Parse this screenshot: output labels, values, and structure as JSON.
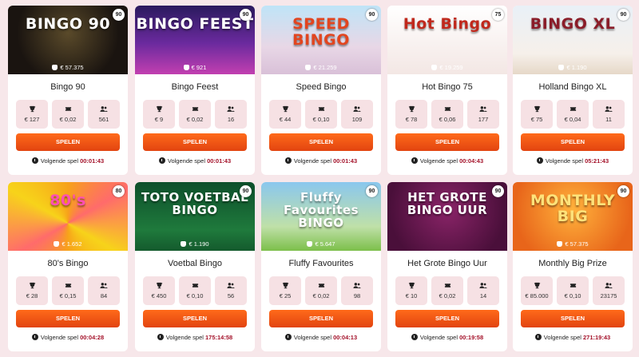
{
  "labels": {
    "play": "SPELEN",
    "next_game": "Volgende spel"
  },
  "colors": {
    "page_bg": "#f7e7ea",
    "button": "#f05a16",
    "time": "#a4122a",
    "stat_bg": "#f6e1e4"
  },
  "games": [
    {
      "name": "Bingo 90",
      "banner_text": "BINGO 90",
      "balls": "90",
      "jackpot": "€ 57.375",
      "prize": "€ 127",
      "ticket": "€ 0,02",
      "players": "561",
      "time": "00:01:43",
      "theme": "gold"
    },
    {
      "name": "Bingo Feest",
      "banner_text": "BINGO FEEST",
      "balls": "90",
      "jackpot": "€ 921",
      "prize": "€ 9",
      "ticket": "€ 0,02",
      "players": "16",
      "time": "00:01:43",
      "theme": "purple"
    },
    {
      "name": "Speed Bingo",
      "banner_text": "SPEED BINGO",
      "balls": "90",
      "jackpot": "€ 21.259",
      "prize": "€ 44",
      "ticket": "€ 0,10",
      "players": "109",
      "time": "00:01:43",
      "theme": "sky"
    },
    {
      "name": "Hot Bingo 75",
      "banner_text": "Hot Bingo",
      "balls": "75",
      "jackpot": "€ 19.259",
      "prize": "€ 78",
      "ticket": "€ 0,06",
      "players": "177",
      "time": "00:04:43",
      "theme": "hot"
    },
    {
      "name": "Holland Bingo XL",
      "banner_text": "BINGO XL",
      "balls": "90",
      "jackpot": "€ 1.190",
      "prize": "€ 75",
      "ticket": "€ 0,04",
      "players": "11",
      "time": "05:21:43",
      "theme": "holland"
    },
    {
      "name": "80's Bingo",
      "banner_text": "80's",
      "balls": "80",
      "jackpot": "€ 1.652",
      "prize": "€ 28",
      "ticket": "€ 0,15",
      "players": "84",
      "time": "00:04:28",
      "theme": "eighties"
    },
    {
      "name": "Voetbal Bingo",
      "banner_text": "TOTO VOETBAL BINGO",
      "balls": "90",
      "jackpot": "€ 1.190",
      "prize": "€ 450",
      "ticket": "€ 0,10",
      "players": "56",
      "time": "175:14:58",
      "theme": "football"
    },
    {
      "name": "Fluffy Favourites",
      "banner_text": "Fluffy Favourites BINGO",
      "balls": "90",
      "jackpot": "€ 5.647",
      "prize": "€ 25",
      "ticket": "€ 0,02",
      "players": "98",
      "time": "00:04:13",
      "theme": "fluffy"
    },
    {
      "name": "Het Grote Bingo Uur",
      "banner_text": "HET GROTE BINGO UUR",
      "balls": "90",
      "jackpot": "",
      "prize": "€ 10",
      "ticket": "€ 0,02",
      "players": "14",
      "time": "00:19:58",
      "theme": "grote"
    },
    {
      "name": "Monthly Big Prize",
      "banner_text": "MONTHLY BIG",
      "balls": "90",
      "jackpot": "€ 57.375",
      "prize": "€ 85.000",
      "ticket": "€ 0,10",
      "players": "23175",
      "time": "271:19:43",
      "theme": "monthly"
    }
  ]
}
